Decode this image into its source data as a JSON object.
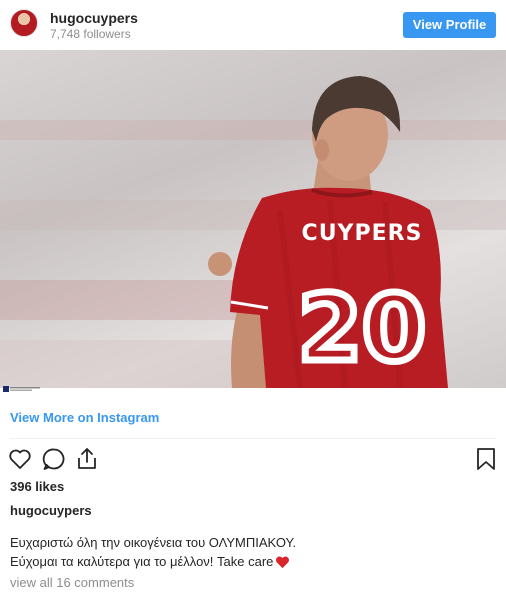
{
  "header": {
    "username": "hugocuypers",
    "followers": "7,748 followers",
    "view_profile_label": "View Profile"
  },
  "photo": {
    "jersey_name": "CUYPERS",
    "jersey_number": "20",
    "colors": {
      "jersey": "#b81d24",
      "background": "#d6d1d1"
    }
  },
  "view_more_label": "View More on Instagram",
  "actions": {
    "icons": [
      "heart-icon",
      "comment-icon",
      "share-icon",
      "bookmark-icon"
    ]
  },
  "likes": "396 likes",
  "caption": {
    "username": "hugocuypers",
    "line1": "Ευχαριστώ όλη την οικογένεια του ΟΛΥΜΠΙΑΚΟΥ.",
    "line2": "Εύχομαι τα καλύτερα για το μέλλον! Take care"
  },
  "comments_label": "view all 16 comments",
  "accent": "#3897f0"
}
